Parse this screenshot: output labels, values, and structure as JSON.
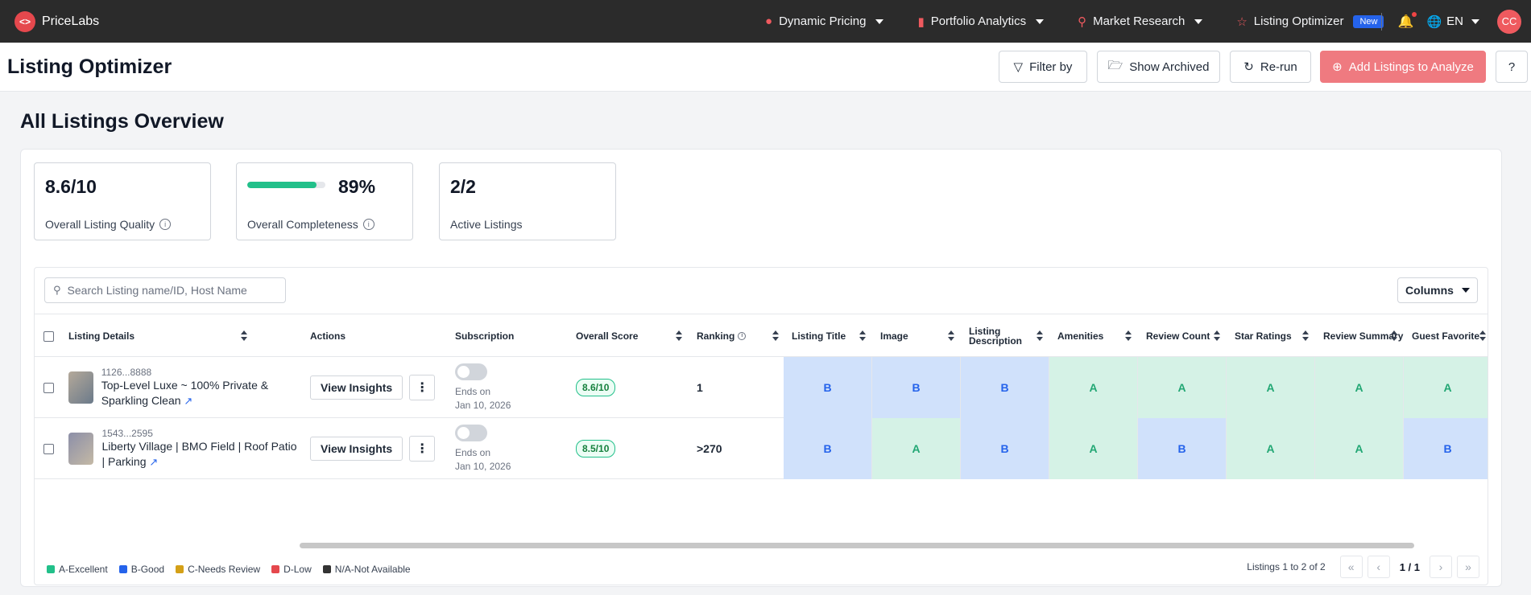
{
  "nav": {
    "brand": "PriceLabs",
    "logo_glyph": "<>",
    "items": [
      {
        "label": "Dynamic Pricing",
        "icon": "flame-icon"
      },
      {
        "label": "Portfolio Analytics",
        "icon": "bar-chart-icon"
      },
      {
        "label": "Market Research",
        "icon": "magnifier-chart-icon"
      },
      {
        "label": "Listing Optimizer",
        "icon": "star-icon",
        "badge": "New"
      }
    ],
    "language": "EN",
    "avatar": "CC"
  },
  "header": {
    "title": "Listing Optimizer",
    "filter": "Filter by",
    "archived": "Show Archived",
    "rerun": "Re-run",
    "add": "Add Listings to Analyze",
    "help": "?"
  },
  "overview": {
    "title": "All Listings Overview",
    "quality": {
      "value": "8.6/10",
      "label": "Overall Listing Quality"
    },
    "completeness": {
      "value": "89%",
      "label": "Overall Completeness",
      "fraction": 0.89
    },
    "active": {
      "value": "2/2",
      "label": "Active Listings"
    }
  },
  "table": {
    "search_placeholder": "Search Listing name/ID, Host Name",
    "columns_label": "Columns",
    "headers": {
      "details": "Listing Details",
      "actions": "Actions",
      "subscription": "Subscription",
      "score": "Overall Score",
      "ranking": "Ranking",
      "grades": [
        "Listing Title",
        "Image",
        "Listing Description",
        "Amenities",
        "Review Count",
        "Star Ratings",
        "Review Summary",
        "Guest Favorite"
      ]
    },
    "view_label": "View Insights",
    "rows": [
      {
        "id": "1126...8888",
        "name": "Top-Level Luxe ~ 100% Private & Sparkling Clean",
        "ends_label": "Ends on",
        "ends_date": "Jan 10, 2026",
        "score": "8.6/10",
        "ranking": "1",
        "grades": [
          "B",
          "B",
          "B",
          "A",
          "A",
          "A",
          "A",
          "A"
        ]
      },
      {
        "id": "1543...2595",
        "name": "Liberty Village | BMO Field | Roof Patio | Parking",
        "ends_label": "Ends on",
        "ends_date": "Jan 10, 2026",
        "score": "8.5/10",
        "ranking": ">270",
        "grades": [
          "B",
          "A",
          "B",
          "A",
          "B",
          "A",
          "A",
          "B"
        ]
      }
    ],
    "legend": [
      {
        "label": "A-Excellent",
        "color": "#22c08a"
      },
      {
        "label": "B-Good",
        "color": "#2563eb"
      },
      {
        "label": "C-Needs Review",
        "color": "#d4a017"
      },
      {
        "label": "D-Low",
        "color": "#e5484d"
      },
      {
        "label": "N/A-Not Available",
        "color": "#333333"
      }
    ],
    "pager_text": "Listings 1 to 2 of 2",
    "page": "1 / 1"
  }
}
